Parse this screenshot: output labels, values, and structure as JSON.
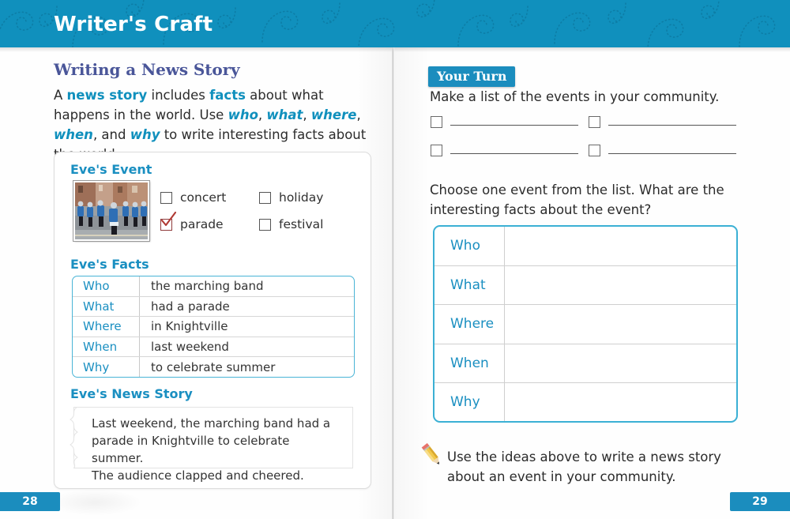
{
  "header": {
    "title": "Writer's Craft",
    "band_color": "#1090bd",
    "swirl_icon": "dotted-spiral-icon"
  },
  "left_page": {
    "heading": "Writing a News Story",
    "intro": {
      "line1_a": "A ",
      "kw_news_story": "news story",
      "line1_b": " includes ",
      "kw_facts": "facts",
      "line1_c": " about what happens in the world. Use ",
      "kw_who": "who",
      "sep1": ", ",
      "kw_what": "what",
      "sep2": ", ",
      "kw_where": "where",
      "sep3": ", ",
      "kw_when": "when",
      "sep4": ", and ",
      "kw_why": "why",
      "line1_d": " to write interesting facts about the world."
    },
    "event_label": "Eve's Event",
    "photo_alt": "marching-band-photo",
    "checkboxes": [
      {
        "label": "concert",
        "checked": false
      },
      {
        "label": "holiday",
        "checked": false
      },
      {
        "label": "parade",
        "checked": true
      },
      {
        "label": "festival",
        "checked": false
      }
    ],
    "facts_label": "Eve's Facts",
    "facts_rows": [
      {
        "key": "Who",
        "value": "the marching band"
      },
      {
        "key": "What",
        "value": "had a parade"
      },
      {
        "key": "Where",
        "value": "in Knightville"
      },
      {
        "key": "When",
        "value": "last weekend"
      },
      {
        "key": "Why",
        "value": "to celebrate summer"
      }
    ],
    "story_label": "Eve's News Story",
    "story_lines": [
      "Last weekend, the marching band had a",
      "parade in Knightville to celebrate summer.",
      "The audience clapped and cheered."
    ],
    "page_number": "28"
  },
  "right_page": {
    "badge": "Your Turn",
    "question1": "Make a list of the events in your community.",
    "blank_rows": [
      {
        "left": "",
        "right": ""
      },
      {
        "left": "",
        "right": ""
      }
    ],
    "question2": "Choose one event from the list. What are the interesting facts about the event?",
    "answer_rows": [
      {
        "key": "Who",
        "value": ""
      },
      {
        "key": "What",
        "value": ""
      },
      {
        "key": "Where",
        "value": ""
      },
      {
        "key": "When",
        "value": ""
      },
      {
        "key": "Why",
        "value": ""
      }
    ],
    "footnote": "Use the ideas above to write a news story about an event in your community.",
    "pencil_icon": "pencil-icon",
    "page_number": "29"
  },
  "colors": {
    "header_blue": "#1090bd",
    "heading_purple": "#4a5699",
    "accent_blue": "#1a8fc1",
    "table_border": "#49b4d6",
    "check_red": "#b03a34"
  }
}
